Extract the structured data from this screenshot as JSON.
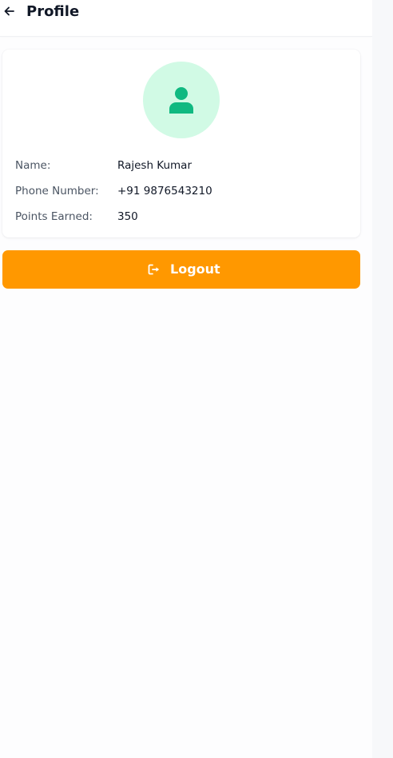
{
  "header": {
    "title": "Profile",
    "back_icon": "arrow-left-icon"
  },
  "profile": {
    "avatar_icon": "user-icon",
    "name_label": "Name:",
    "name_value": "Rajesh Kumar",
    "phone_label": "Phone Number:",
    "phone_value": "+91 9876543210",
    "points_label": "Points Earned:",
    "points_value": "350"
  },
  "logout": {
    "label": "Logout",
    "icon": "logout-icon"
  },
  "colors": {
    "accent": "#ff9800",
    "avatar_bg": "#d1fae5",
    "avatar_icon": "#10b981",
    "text_primary": "#111827",
    "text_secondary": "#4b5563"
  }
}
